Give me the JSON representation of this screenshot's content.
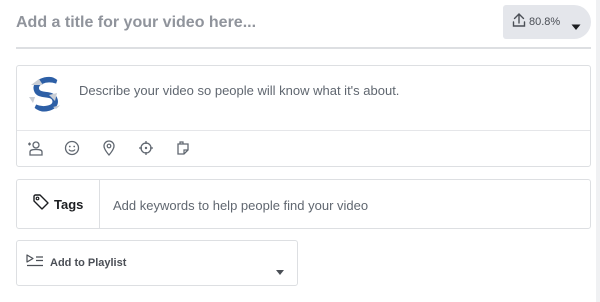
{
  "title": {
    "placeholder": "Add a title for your video here...",
    "upload_progress": "80.8%"
  },
  "description": {
    "placeholder": "Describe your video so people will know what it's about.",
    "toolbar": [
      {
        "icon": "tag-people-icon"
      },
      {
        "icon": "emoji-icon"
      },
      {
        "icon": "location-pin-icon"
      },
      {
        "icon": "crosshair-icon"
      },
      {
        "icon": "sticker-icon"
      }
    ]
  },
  "tags": {
    "label": "Tags",
    "placeholder": "Add keywords to help people find your video"
  },
  "playlist": {
    "label": "Add to Playlist"
  },
  "colors": {
    "avatar_blue": "#2d5fa6",
    "avatar_grey": "#c9cdd4",
    "border": "#dddfe2",
    "placeholder_text": "#90949c"
  }
}
